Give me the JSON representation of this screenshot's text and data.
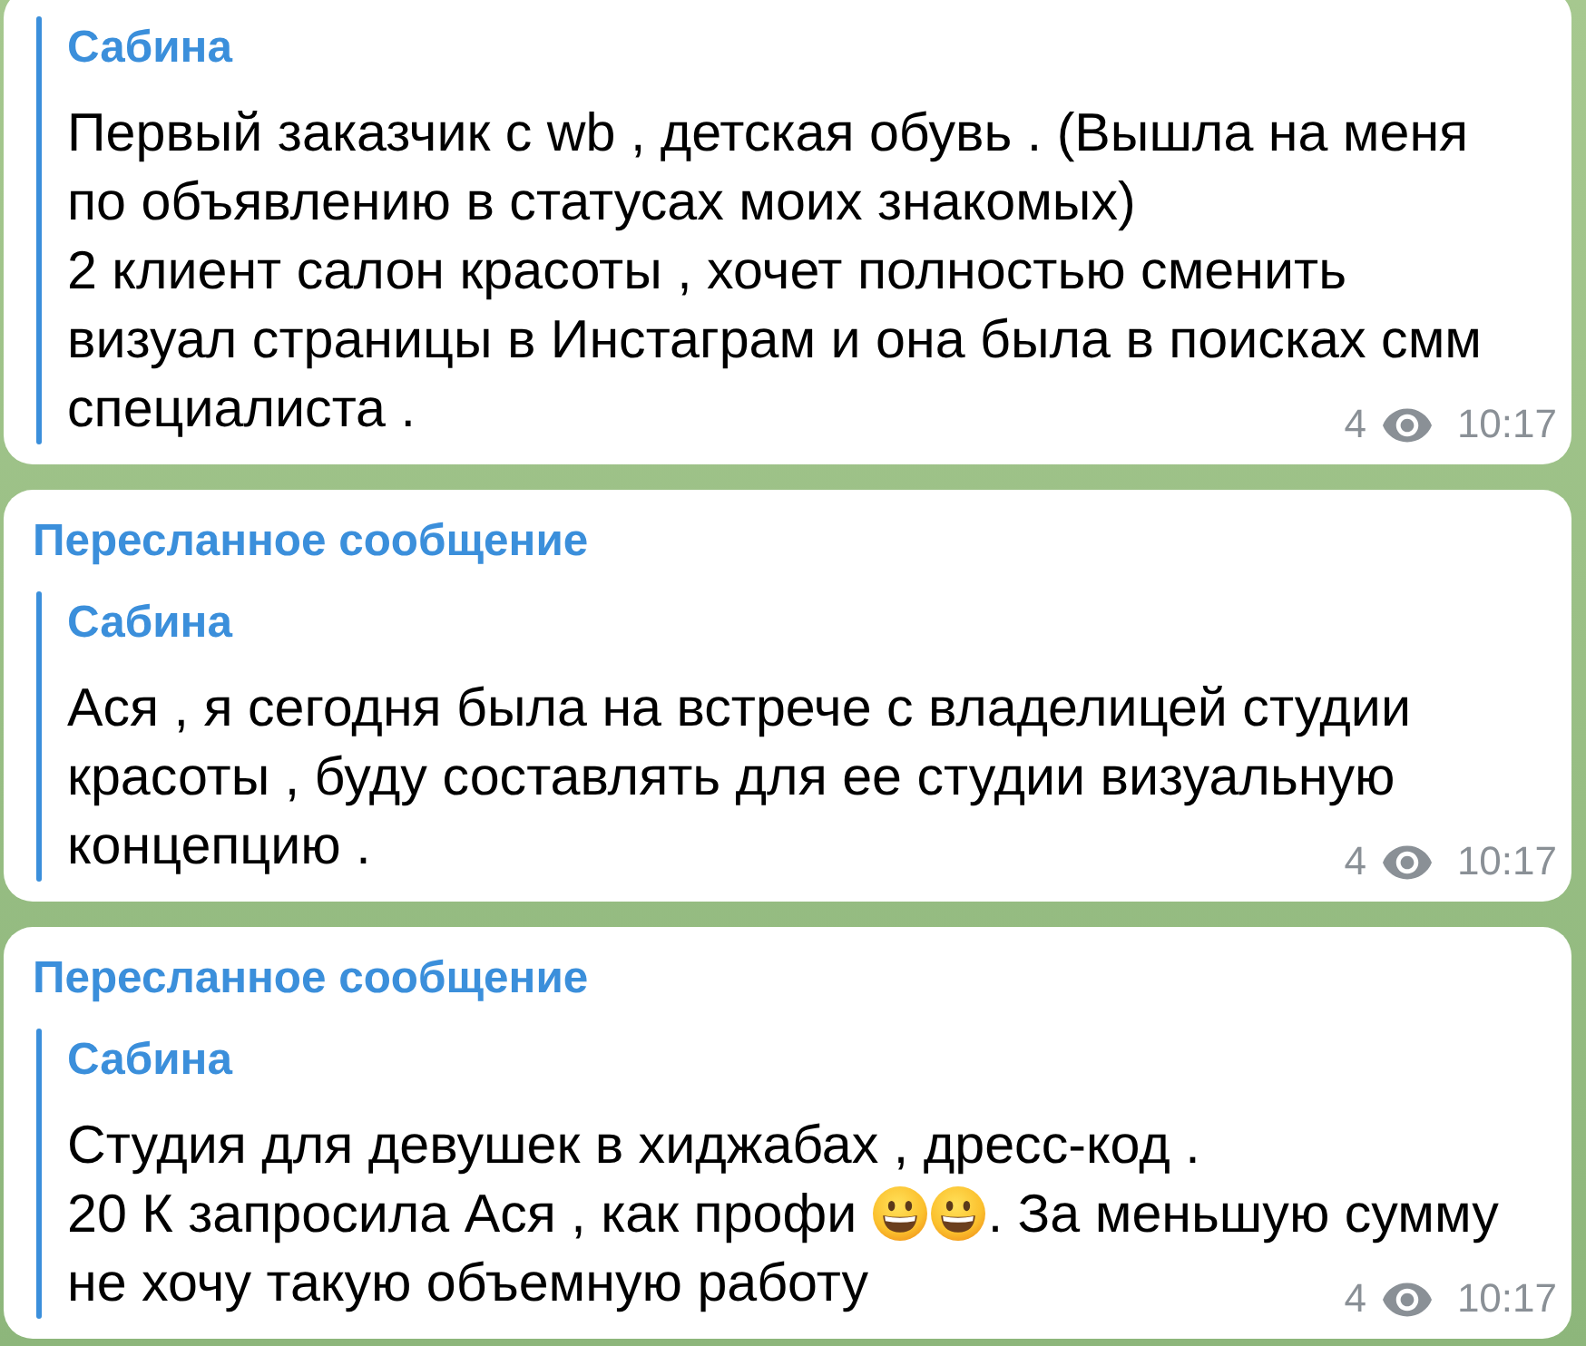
{
  "messages": [
    {
      "quote_author": "Сабина",
      "body": [
        {
          "kind": "text",
          "text": "Первый заказчик с wb , детская обувь . (Вышла на меня по объявлению в статусах моих знакомых)\n2 клиент салон красоты , хочет полностью сменить визуал страницы в Инстаграм и она была в поисках смм специалиста ."
        }
      ],
      "views": "4",
      "time": "10:17"
    },
    {
      "forward_label": "Пересланное сообщение",
      "quote_author": "Сабина",
      "body": [
        {
          "kind": "text",
          "text": "Ася , я сегодня была на встрече с владелицей студии красоты , буду составлять для ее студии визуальную концепцию ."
        }
      ],
      "views": "4",
      "time": "10:17"
    },
    {
      "forward_label": "Пересланное сообщение",
      "quote_author": "Сабина",
      "body": [
        {
          "kind": "text",
          "text": "Студия для девушек в хиджабах , дресс-код .\n20 К запросила Ася , как профи "
        },
        {
          "kind": "emoji"
        },
        {
          "kind": "emoji"
        },
        {
          "kind": "text",
          "text": ". За меньшую сумму не хочу такую объемную работу"
        }
      ],
      "views": "4",
      "time": "10:17"
    }
  ]
}
